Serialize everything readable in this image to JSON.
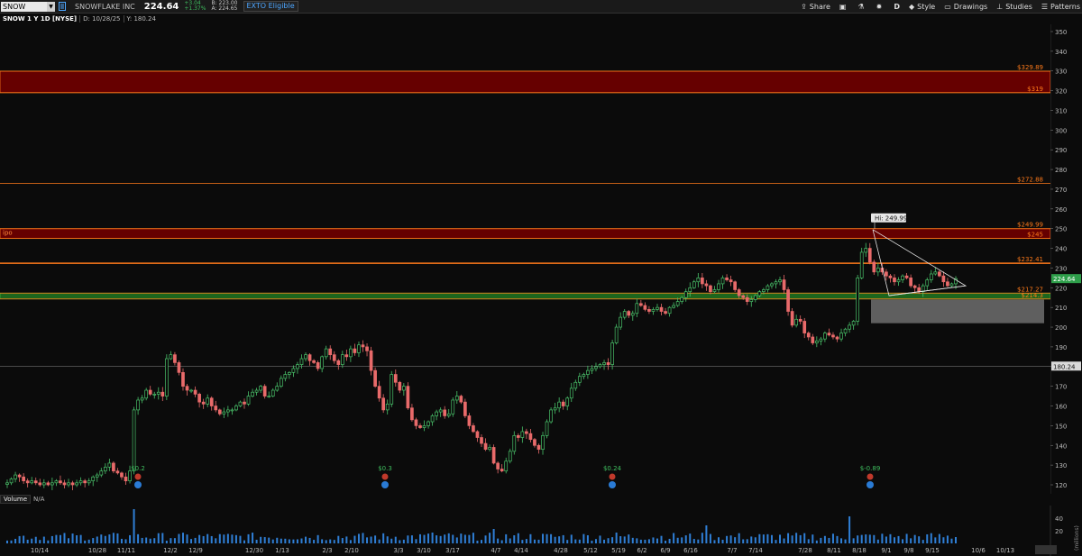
{
  "toolbar": {
    "symbol": "SNOW",
    "company": "SNOWFLAKE INC",
    "last": "224.64",
    "change": "+3.04",
    "change_pct": "+1.37%",
    "bid": "B: 223.00",
    "ask": "A: 224.65",
    "exto": "EXTO Eligible",
    "share": "Share",
    "period": "D",
    "style": "Style",
    "drawings": "Drawings",
    "studies": "Studies",
    "patterns": "Patterns"
  },
  "info": {
    "title": "SNOW 1 Y 1D [NYSE]",
    "date": "D: 10/28/25",
    "value": "Y: 180.24"
  },
  "volume": {
    "title": "Volume",
    "value": "N/A",
    "units": "(millions)",
    "ticks": [
      "40",
      "20"
    ]
  },
  "chart_data": {
    "type": "candlestick",
    "ylim": [
      116,
      353
    ],
    "y_ticks": [
      120,
      130,
      140,
      150,
      160,
      170,
      180,
      190,
      200,
      210,
      220,
      230,
      240,
      250,
      260,
      270,
      280,
      290,
      300,
      310,
      320,
      330,
      340,
      350
    ],
    "x_labels": [
      "10/14",
      "10/28",
      "11/11",
      "12/2",
      "12/9",
      "12/30",
      "1/13",
      "2/3",
      "2/10",
      "3/3",
      "3/10",
      "3/17",
      "4/7",
      "4/14",
      "4/28",
      "5/12",
      "5/19",
      "6/2",
      "6/9",
      "6/16",
      "7/7",
      "7/14",
      "7/28",
      "8/11",
      "8/18",
      "9/1",
      "9/8",
      "9/15",
      "10/6",
      "10/13",
      "10/28"
    ],
    "last_price": "224.64",
    "crosshair_y": "180.24",
    "high_label": "Hi: 249.99",
    "earnings": [
      "$0.2",
      "$0.3",
      "$0.24",
      "$-0.89"
    ],
    "levels": [
      {
        "label": "$329.89",
        "value": 329.89,
        "color": "#ff7a1a"
      },
      {
        "label": "$319",
        "value": 319,
        "color": "#ff7a1a"
      },
      {
        "label": "$272.88",
        "value": 272.88,
        "color": "#ff7a1a"
      },
      {
        "label": "$249.99",
        "value": 249.99,
        "color": "#ff7a1a"
      },
      {
        "label": "$245",
        "value": 245,
        "color": "#ff7a1a"
      },
      {
        "label": "$232.41",
        "value": 232.41,
        "color": "#ff7a1a"
      },
      {
        "label": "$217.27",
        "value": 217.27,
        "color": "#ff7a1a"
      },
      {
        "label": "$214.3",
        "value": 214.3,
        "color": "#ff7a1a"
      }
    ],
    "zones": [
      {
        "from": 319,
        "to": 329.89,
        "color": "#6b0000"
      },
      {
        "from": 245,
        "to": 249.99,
        "color": "#6b0000",
        "label": "ipo"
      },
      {
        "from": 214.3,
        "to": 217.27,
        "color": "#1f6b1f"
      },
      {
        "from": 202,
        "to": 214,
        "color": "#6e6e6e"
      }
    ],
    "series": [
      {
        "name": "price",
        "values": [
          121,
          123,
          125,
          124,
          122,
          121,
          122,
          121,
          120,
          121,
          120,
          121,
          122,
          121,
          120,
          121,
          120,
          121,
          122,
          121,
          122,
          124,
          125,
          127,
          129,
          131,
          127,
          126,
          124,
          122,
          127,
          158,
          163,
          164,
          168,
          166,
          166,
          167,
          165,
          184,
          186,
          182,
          177,
          170,
          168,
          168,
          166,
          162,
          161,
          164,
          160,
          158,
          156,
          157,
          158,
          158,
          160,
          162,
          161,
          165,
          167,
          168,
          170,
          165,
          165,
          168,
          170,
          174,
          176,
          177,
          179,
          181,
          184,
          186,
          183,
          182,
          179,
          185,
          189,
          186,
          183,
          181,
          186,
          185,
          189,
          187,
          191,
          190,
          188,
          178,
          170,
          164,
          158,
          161,
          176,
          172,
          168,
          170,
          159,
          153,
          150,
          149,
          150,
          152,
          155,
          157,
          158,
          155,
          156,
          163,
          165,
          162,
          155,
          150,
          147,
          144,
          141,
          138,
          139,
          131,
          128,
          127,
          132,
          137,
          145,
          144,
          147,
          146,
          143,
          140,
          138,
          145,
          152,
          158,
          159,
          162,
          160,
          164,
          169,
          172,
          175,
          176,
          178,
          179,
          180,
          181,
          182,
          181,
          192,
          200,
          205,
          208,
          206,
          207,
          212,
          211,
          209,
          208,
          209,
          210,
          208,
          207,
          210,
          211,
          213,
          215,
          218,
          220,
          223,
          225,
          222,
          221,
          218,
          219,
          222,
          225,
          224,
          223,
          219,
          216,
          215,
          213,
          214,
          216,
          218,
          219,
          221,
          222,
          223,
          224,
          219,
          208,
          201,
          204,
          203,
          197,
          195,
          192,
          193,
          194,
          197,
          196,
          195,
          194,
          197,
          199,
          201,
          203,
          225,
          238,
          240,
          233,
          228,
          230,
          228,
          226,
          225,
          223,
          224,
          226,
          225,
          221,
          220,
          218,
          221,
          224,
          227,
          228,
          226,
          223,
          221,
          222,
          224.64
        ]
      }
    ]
  }
}
